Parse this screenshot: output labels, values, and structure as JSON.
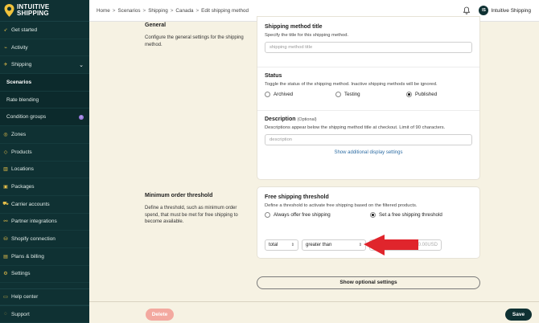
{
  "brand": {
    "line1": "INTUITIVE",
    "line2": "SHIPPING"
  },
  "colors": {
    "sidebar": "#0f3133",
    "accent": "#e7c04a",
    "delete": "#f3a9a0",
    "save": "#0f3133",
    "arrow": "#e0252c",
    "link": "#2e6da4"
  },
  "sidebar": {
    "items": [
      {
        "label": "Get started",
        "icon": "rocket-icon"
      },
      {
        "label": "Activity",
        "icon": "activity-icon"
      },
      {
        "label": "Shipping",
        "icon": "shipping-icon"
      },
      {
        "label": "Scenarios"
      },
      {
        "label": "Rate blending"
      },
      {
        "label": "Condition groups",
        "badge": "!"
      },
      {
        "label": "Zones",
        "icon": "zones-icon"
      },
      {
        "label": "Products",
        "icon": "products-icon"
      },
      {
        "label": "Locations",
        "icon": "locations-icon"
      },
      {
        "label": "Packages",
        "icon": "packages-icon"
      },
      {
        "label": "Carrier accounts",
        "icon": "carrier-icon"
      },
      {
        "label": "Partner integrations",
        "icon": "partner-icon"
      },
      {
        "label": "Shopify connection",
        "icon": "shopify-icon"
      },
      {
        "label": "Plans & billing",
        "icon": "billing-icon"
      },
      {
        "label": "Settings",
        "icon": "gear-icon"
      }
    ],
    "bottom": [
      {
        "label": "Help center",
        "icon": "help-icon"
      },
      {
        "label": "Support",
        "icon": "support-icon"
      }
    ]
  },
  "breadcrumb": [
    "Home",
    "Scenarios",
    "Shipping",
    "Canada",
    "Edit shipping method"
  ],
  "user": {
    "initials": "IS",
    "name": "Intuitive Shipping"
  },
  "general": {
    "title": "General",
    "description": "Configure the general settings for the shipping method."
  },
  "method_title": {
    "heading": "Shipping method title",
    "help": "Specify the title for this shipping method.",
    "placeholder": "shipping method title"
  },
  "status": {
    "heading": "Status",
    "help": "Toggle the status of the shipping method. Inactive shipping methods will be ignored.",
    "options": [
      "Archived",
      "Testing",
      "Published"
    ],
    "selected": "Published"
  },
  "description": {
    "heading": "Description",
    "optional": "(Optional)",
    "help": "Descriptions appear below the shipping method title at checkout. Limit of 90 characters.",
    "placeholder": "description",
    "link": "Show additional display settings"
  },
  "minimum": {
    "title": "Minimum order threshold",
    "description": "Define a threshold, such as minimum order spend, that must be met for free shipping to become available."
  },
  "free_shipping": {
    "heading": "Free shipping threshold",
    "help": "Define a threshold to activate free shipping based on the filtered products.",
    "options": [
      "Always offer free shipping",
      "Set a free shipping threshold"
    ],
    "selected": "Set a free shipping threshold",
    "field": "total",
    "operator": "greater than",
    "unit": "0.00USD"
  },
  "buttons": {
    "optional_settings": "Show optional settings",
    "delete": "Delete",
    "save": "Save"
  }
}
